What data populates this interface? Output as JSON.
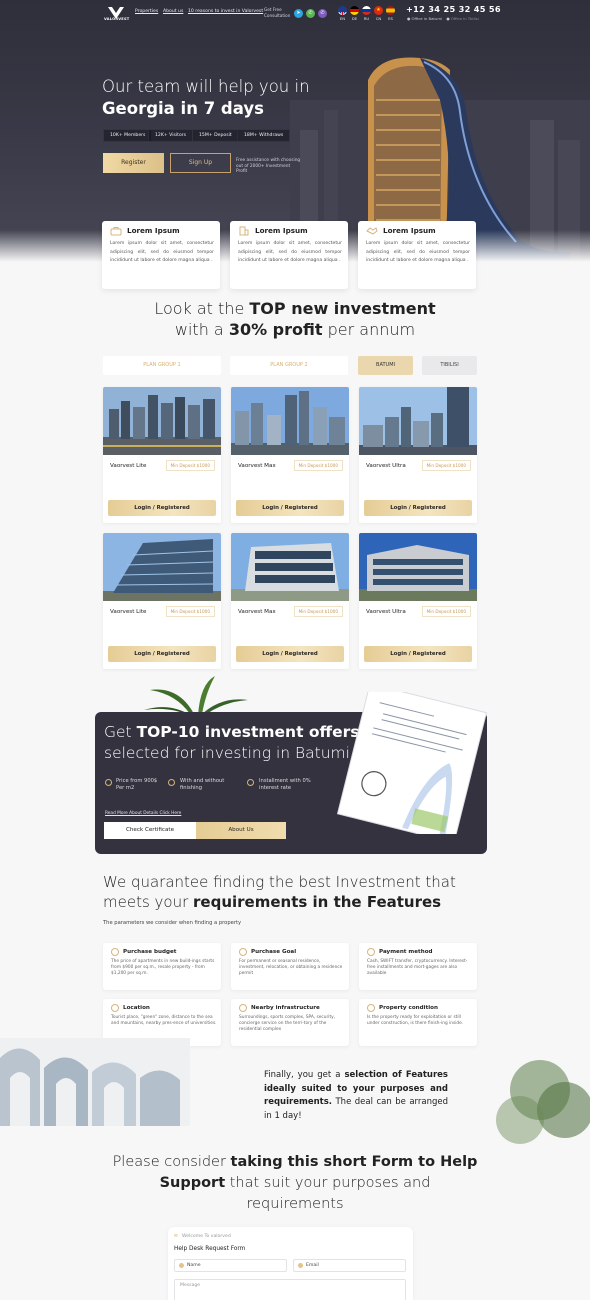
{
  "brand": {
    "logo_text": "VALORVEST"
  },
  "nav": {
    "properties": "Properties",
    "about": "About us",
    "reasons": "10 reasons to invest in Valorvest"
  },
  "consultation": "Get Free Consultation",
  "social": [
    "telegram-icon",
    "viber-icon",
    "whatsapp-icon"
  ],
  "languages": [
    "EN",
    "DE",
    "RU",
    "CN",
    "ES"
  ],
  "contact": {
    "phone": "+12 34 25 32 45 56",
    "office_batumi": "Office in Batumi",
    "office_tbilisi": "Office in Tbilisi"
  },
  "hero": {
    "title_line1": "Our team will help you in",
    "title_line2": "Georgia in 7 days",
    "stats": [
      "10K+ Members",
      "12K+ Visitors",
      "15M+ Deposit",
      "18M+ Withdraws"
    ],
    "register_label": "Register",
    "signup_label": "Sign Up",
    "note": "Free assistance with choosing out of 2000+ Investment Profit"
  },
  "features": [
    {
      "title": "Lorem Ipsum",
      "text": "Lorem ipsum dolor sit amet, consectetur adipiscing elit, sed do eiusmod tempor incididunt ut labore et dolore magna aliqua ."
    },
    {
      "title": "Lorem Ipsum",
      "text": "Lorem ipsum dolor sit amet, consectetur adipiscing elit, sed do eiusmod tempor incididunt ut labore et dolore magna aliqua ."
    },
    {
      "title": "Lorem Ipsum",
      "text": "Lorem ipsum dolor sit amet, consectetur adipiscing elit, sed do eiusmod tempor incididunt ut labore et dolore magna aliqua ."
    }
  ],
  "investment": {
    "title_a": "Look at the ",
    "title_b": "TOP new investment",
    "title_c": "with a ",
    "title_d": "30% profit",
    "title_e": " per annum",
    "tabs": [
      "PLAN GROUP 1",
      "PLAN GROUP 2",
      "BATUMI",
      "TIBILISI"
    ],
    "cards": [
      {
        "name": "Vaorvest Lite",
        "deposit": "Min Deposit $1000",
        "button": "Login / Registered"
      },
      {
        "name": "Vaorvest Max",
        "deposit": "Min Deposit $1000",
        "button": "Login / Registered"
      },
      {
        "name": "Vaorvest Ultra",
        "deposit": "Min Deposit $1000",
        "button": "Login / Registered"
      },
      {
        "name": "Vaorvest Lite",
        "deposit": "Min Deposit $1000",
        "button": "Login / Registered"
      },
      {
        "name": "Vaorvest Max",
        "deposit": "Min Deposit $1000",
        "button": "Login / Registered"
      },
      {
        "name": "Vaorvest Ultra",
        "deposit": "Min Deposit $1000",
        "button": "Login / Registered"
      }
    ]
  },
  "promo": {
    "title_a": "Get ",
    "title_b": "TOP-10 investment offers",
    "title_c": "selected for investing in Batumi",
    "checks": [
      "Price from 900$ Per m2",
      "With and without finishing",
      "Installment with 0% interest rate"
    ],
    "read_more": "Read More About Details Click Here",
    "cert_button": "Check Certificate",
    "about_button": "About Us"
  },
  "guarantee": {
    "title_a": "We quarantee finding the best Investment that meets your ",
    "title_b": "requirements in the Features",
    "subtitle": "The parameters we consider when finding a property",
    "cards": [
      {
        "title": "Purchase budget",
        "text": "The price of apartments in new build-ings starts from $900 per sq.m., resale property - from $1,200 per sq.m."
      },
      {
        "title": "Purchase Goal",
        "text": "For permanent or seasonal residence, investment, relocation, or obtaining a residence permit"
      },
      {
        "title": "Payment method",
        "text": "Cash, SWIFT transfer, cryptocurrency. Interest-free installments and mort-gages are also available"
      },
      {
        "title": "Location",
        "text": "Tourist place, \"green\" zone, distance to the sea and mountains, nearby pres-ence of universities."
      },
      {
        "title": "Nearby infrastructure",
        "text": "Surroundings, sports complex, SPA, security, concierge service on the terri-tory of the residential complex"
      },
      {
        "title": "Property condition",
        "text": "Is the property ready for exploitation or still under construction, is there finish-ing inside."
      }
    ],
    "finally_a": "Finally, you get a ",
    "finally_b": "selection of Features ideally suited to your purposes and requirements.",
    "finally_c": " The deal can be arranged in 1 day!"
  },
  "form": {
    "title_a": "Please consider ",
    "title_b": "taking this short Form to Help Support",
    "title_c": " that suit your purposes and requirements",
    "welcome": "Welcome To valorved",
    "heading": "Help Desk Request Form",
    "name_placeholder": "Name",
    "email_placeholder": "Email",
    "message_placeholder": "Message"
  },
  "colors": {
    "accent_gold": "#d9bd86",
    "dark_bg": "#33323e",
    "page_bg": "#f7f7f8"
  }
}
